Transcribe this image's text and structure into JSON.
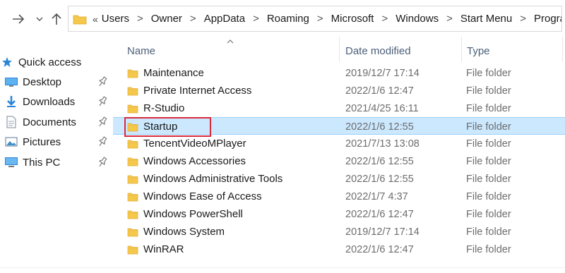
{
  "colors": {
    "folder_yellow": "#f5c84c",
    "selection_bg": "#cce8ff",
    "highlight_border": "#d62b3a",
    "header_text": "#4c607a"
  },
  "toolbar": {
    "back_icon": "arrow-right-icon",
    "recent_icon": "chevron-down-icon",
    "up_icon": "arrow-up-icon"
  },
  "address": {
    "overflow": "«",
    "separator": ">",
    "crumbs": [
      "Users",
      "Owner",
      "AppData",
      "Roaming",
      "Microsoft",
      "Windows",
      "Start Menu",
      "Programs"
    ]
  },
  "nav_pane": {
    "items": [
      {
        "label": "Quick access",
        "icon": "star-icon",
        "pinned": false
      },
      {
        "label": "Desktop",
        "icon": "desktop-icon",
        "pinned": true
      },
      {
        "label": "Downloads",
        "icon": "download-icon",
        "pinned": true
      },
      {
        "label": "Documents",
        "icon": "documents-icon",
        "pinned": true
      },
      {
        "label": "Pictures",
        "icon": "pictures-icon",
        "pinned": true
      },
      {
        "label": "This PC",
        "icon": "computer-icon",
        "pinned": true
      }
    ]
  },
  "list": {
    "columns": {
      "name": "Name",
      "date": "Date modified",
      "type": "Type"
    },
    "sort_indicator": "^",
    "selected_index": 3,
    "rows": [
      {
        "name": "Maintenance",
        "date": "2019/12/7 17:14",
        "type": "File folder"
      },
      {
        "name": "Private Internet Access",
        "date": "2022/1/6 12:47",
        "type": "File folder"
      },
      {
        "name": "R-Studio",
        "date": "2021/4/25 16:11",
        "type": "File folder"
      },
      {
        "name": "Startup",
        "date": "2022/1/6 12:55",
        "type": "File folder"
      },
      {
        "name": "TencentVideoMPlayer",
        "date": "2021/7/13 13:08",
        "type": "File folder"
      },
      {
        "name": "Windows Accessories",
        "date": "2022/1/6 12:55",
        "type": "File folder"
      },
      {
        "name": "Windows Administrative Tools",
        "date": "2022/1/6 12:55",
        "type": "File folder"
      },
      {
        "name": "Windows Ease of Access",
        "date": "2022/1/7 4:37",
        "type": "File folder"
      },
      {
        "name": "Windows PowerShell",
        "date": "2022/1/6 12:47",
        "type": "File folder"
      },
      {
        "name": "Windows System",
        "date": "2019/12/7 17:14",
        "type": "File folder"
      },
      {
        "name": "WinRAR",
        "date": "2022/1/6 12:47",
        "type": "File folder"
      }
    ]
  }
}
